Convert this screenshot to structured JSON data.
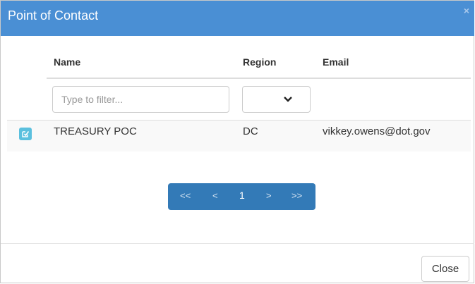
{
  "modal": {
    "title": "Point of Contact",
    "close_glyph": "×",
    "close_label": "Close"
  },
  "table": {
    "columns": {
      "name": "Name",
      "region": "Region",
      "email": "Email"
    },
    "filter": {
      "name_placeholder": "Type to filter...",
      "region_selected": ""
    },
    "rows": [
      {
        "name": "TREASURY POC",
        "region": "DC",
        "email": "vikkey.owens@dot.gov"
      }
    ]
  },
  "pagination": {
    "first": "<<",
    "prev": "<",
    "current": "1",
    "next": ">",
    "last": ">>"
  },
  "colors": {
    "header_bg": "#4a8fd4",
    "pager_bg": "#337ab7",
    "edit_button_bg": "#5bc0de"
  }
}
